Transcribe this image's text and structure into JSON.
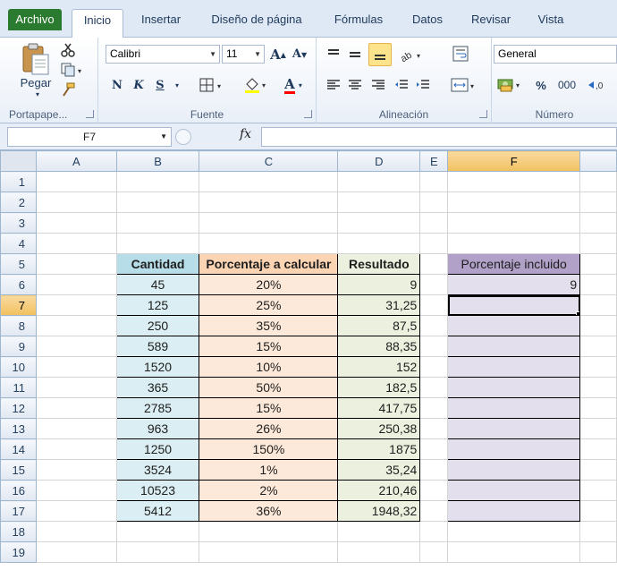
{
  "ribbon": {
    "tabs": [
      "Archivo",
      "Inicio",
      "Insertar",
      "Diseño de página",
      "Fórmulas",
      "Datos",
      "Revisar",
      "Vista"
    ],
    "clipboard": {
      "paste_label": "Pegar",
      "group_label": "Portapape..."
    },
    "font": {
      "name": "Calibri",
      "size": "11",
      "bold": "N",
      "italic": "K",
      "underline": "S",
      "grow": "A",
      "shrink": "A",
      "color_letter": "A",
      "group_label": "Fuente"
    },
    "alignment": {
      "group_label": "Alineación"
    },
    "number": {
      "format": "General",
      "percent": "%",
      "thousands": "000",
      "group_label": "Número"
    }
  },
  "formula_bar": {
    "name_box": "F7",
    "fx": "fx",
    "formula": ""
  },
  "sheet": {
    "columns": [
      "A",
      "B",
      "C",
      "D",
      "E",
      "F"
    ],
    "rows": [
      "1",
      "2",
      "3",
      "4",
      "5",
      "6",
      "7",
      "8",
      "9",
      "10",
      "11",
      "12",
      "13",
      "14",
      "15",
      "16",
      "17",
      "18",
      "19"
    ],
    "headers": {
      "b": "Cantidad",
      "c": "Porcentaje a calcular",
      "d": "Resultado",
      "f": "Porcentaje incluido"
    },
    "data": [
      {
        "b": "45",
        "c": "20%",
        "d": "9",
        "f": "9"
      },
      {
        "b": "125",
        "c": "25%",
        "d": "31,25",
        "f": ""
      },
      {
        "b": "250",
        "c": "35%",
        "d": "87,5",
        "f": ""
      },
      {
        "b": "589",
        "c": "15%",
        "d": "88,35",
        "f": ""
      },
      {
        "b": "1520",
        "c": "10%",
        "d": "152",
        "f": ""
      },
      {
        "b": "365",
        "c": "50%",
        "d": "182,5",
        "f": ""
      },
      {
        "b": "2785",
        "c": "15%",
        "d": "417,75",
        "f": ""
      },
      {
        "b": "963",
        "c": "26%",
        "d": "250,38",
        "f": ""
      },
      {
        "b": "1250",
        "c": "150%",
        "d": "1875",
        "f": ""
      },
      {
        "b": "3524",
        "c": "1%",
        "d": "35,24",
        "f": ""
      },
      {
        "b": "10523",
        "c": "2%",
        "d": "210,46",
        "f": ""
      },
      {
        "b": "5412",
        "c": "36%",
        "d": "1948,32",
        "f": ""
      }
    ]
  },
  "colors": {
    "file_tab": "#2a7a2f",
    "header_blue": "#b7dde8",
    "header_orange": "#fbd4b4",
    "header_green": "#ebf1de",
    "header_purple": "#b1a0c7"
  },
  "icons": [
    "paste-icon",
    "cut-icon",
    "copy-icon",
    "format-painter-icon",
    "borders-icon",
    "fill-color-icon",
    "wrap-text-icon",
    "merge-icon",
    "currency-icon"
  ]
}
